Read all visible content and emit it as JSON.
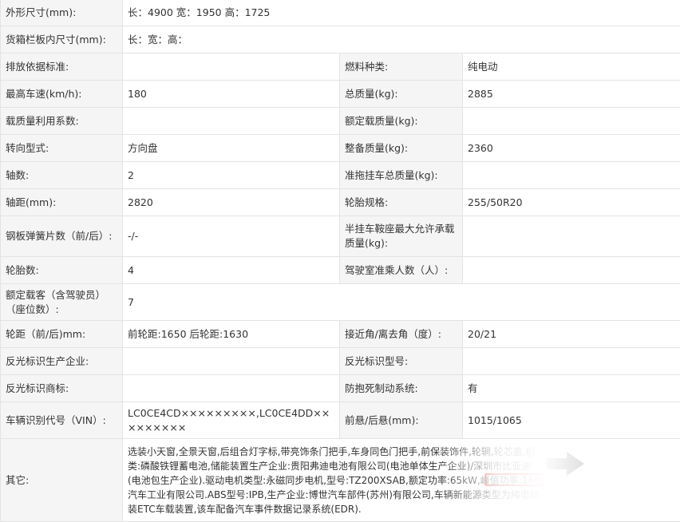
{
  "rows": [
    {
      "l1": "外形尺寸(mm):",
      "v1": "长：4900 宽：1950 高：1725"
    },
    {
      "l1": "货箱栏板内尺寸(mm):",
      "v1": "长：宽：高："
    },
    {
      "l1": "排放依据标准:",
      "v1": "",
      "l2": "燃料种类:",
      "v2": "纯电动"
    },
    {
      "l1": "最高车速(km/h):",
      "v1": "180",
      "l2": "总质量(kg):",
      "v2": "2885"
    },
    {
      "l1": "载质量利用系数:",
      "v1": "",
      "l2": "额定载质量(kg):",
      "v2": ""
    },
    {
      "l1": "转向型式:",
      "v1": "方向盘",
      "l2": "整备质量(kg):",
      "v2": "2360"
    },
    {
      "l1": "轴数:",
      "v1": "2",
      "l2": "准拖挂车总质量(kg):",
      "v2": ""
    },
    {
      "l1": "轴距(mm):",
      "v1": "2820",
      "l2": "轮胎规格:",
      "v2": "255/50R20"
    },
    {
      "l1": "钢板弹簧片数（前/后）:",
      "v1": "-/-",
      "l2": "半挂车鞍座最大允许承载质量(kg):",
      "v2": ""
    },
    {
      "l1": "轮胎数:",
      "v1": "4",
      "l2": "驾驶室准乘人数（人）:",
      "v2": ""
    },
    {
      "l1": "额定载客（含驾驶员）（座位数）:",
      "v1": "7"
    },
    {
      "l1": "轮距（前/后)mm:",
      "v1": "前轮距:1650 后轮距:1630",
      "l2": "接近角/离去角（度）:",
      "v2": "20/21"
    },
    {
      "l1": "反光标识生产企业:",
      "v1": "",
      "l2": "反光标识型号:",
      "v2": ""
    },
    {
      "l1": "反光标识商标:",
      "v1": "",
      "l2": "防抱死制动系统:",
      "v2": "有"
    },
    {
      "l1": "车辆识别代号（VIN）:",
      "v1": "LC0CE4CD×××××××××,LC0CE4DD×××××××××",
      "l2": "前悬/后悬(mm):",
      "v2": "1015/1065"
    }
  ],
  "other": {
    "label": "其它:",
    "lines": [
      "选装小天窗,全景天窗,后组合灯字标,带亮饰条门把手,车身同色门把手,前保装饰件,轮辋,轮芯盖,前",
      "类:磷酸铁锂蓄电池,储能装置生产企业:贵阳弗迪电池有限公司(电池单体生产企业)/深圳市比亚迪",
      "(电池包生产企业).驱动电机类型:永磁同步电机,型号:TZ200XSAB,额定功率:65kW,峰值功率:168",
      "汽车工业有限公司.ABS型号:IPB,生产企业:博世汽车部件(苏州)有限公司,车辆新能源类型为纯电动",
      "装ETC车载装置,该车配备汽车事件数据记录系统(EDR)."
    ]
  },
  "colors": {
    "highlight_box": "#d9302c",
    "label_bg": "#f5f5f5",
    "border": "#e3e3e3"
  },
  "icons": {
    "arrow": "right-arrow-icon"
  }
}
